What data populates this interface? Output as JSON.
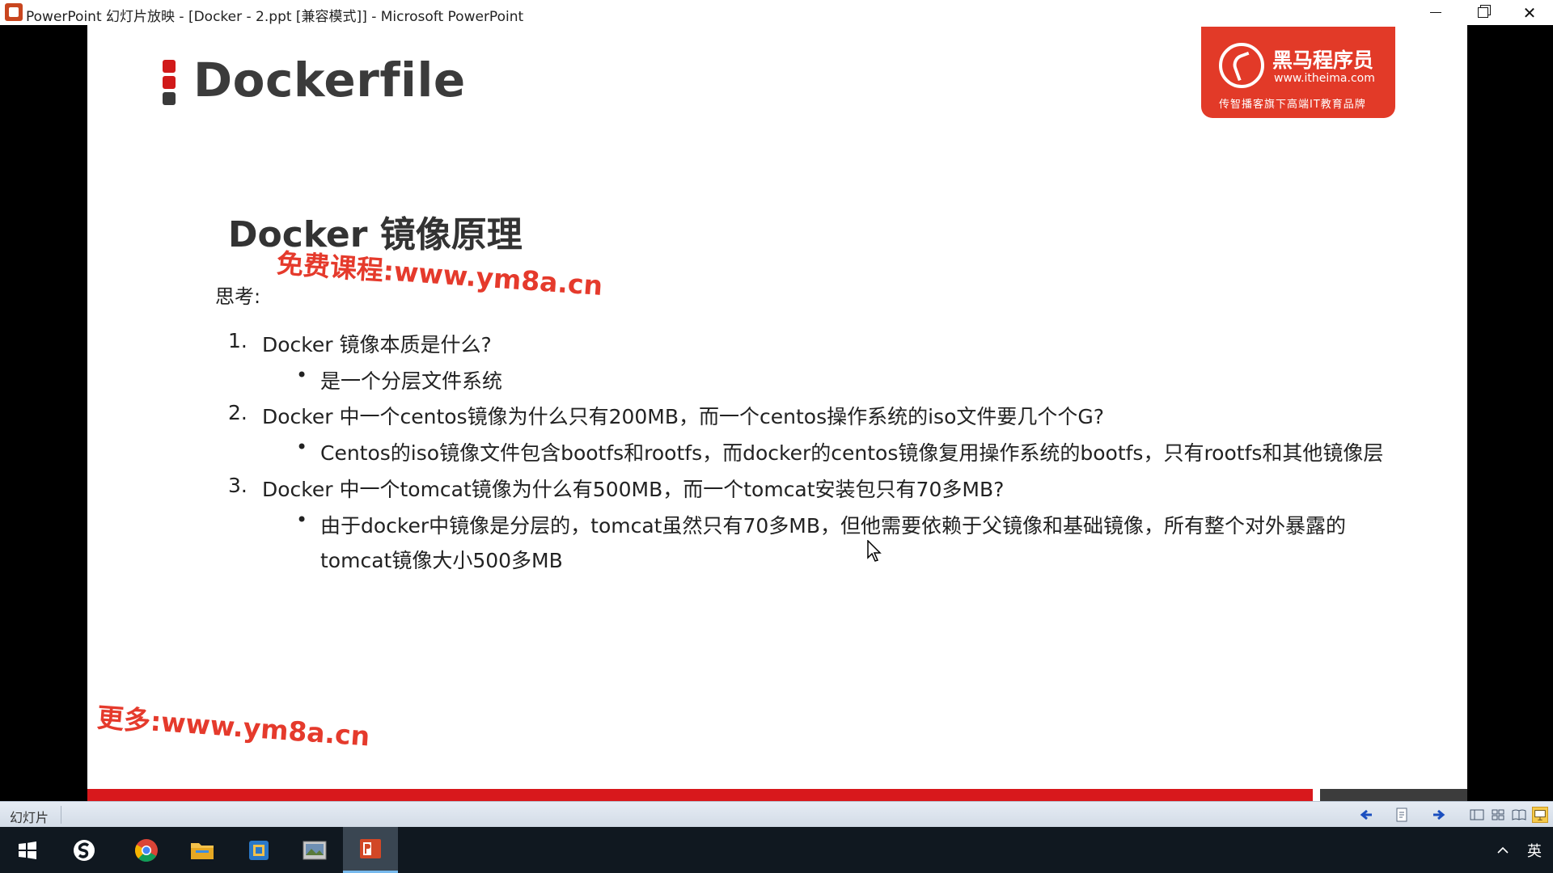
{
  "window": {
    "title": "PowerPoint 幻灯片放映 - [Docker - 2.ppt [兼容模式]] - Microsoft PowerPoint"
  },
  "slide": {
    "title": "Dockerfile",
    "logo": {
      "name": "黑马程序员",
      "url": "www.itheima.com",
      "tagline": "传智播客旗下高端IT教育品牌"
    },
    "heading": "Docker 镜像原理",
    "watermark_top": "免费课程:www.ym8a.cn",
    "watermark_bottom": "更多:www.ym8a.cn",
    "think_label": "思考:",
    "questions": [
      {
        "number": "1.",
        "text": "Docker 镜像本质是什么?",
        "answers": [
          "是一个分层文件系统"
        ]
      },
      {
        "number": "2.",
        "text": "Docker 中一个centos镜像为什么只有200MB，而一个centos操作系统的iso文件要几个个G?",
        "answers": [
          "Centos的iso镜像文件包含bootfs和rootfs，而docker的centos镜像复用操作系统的bootfs，只有rootfs和其他镜像层"
        ]
      },
      {
        "number": "3.",
        "text": "Docker 中一个tomcat镜像为什么有500MB，而一个tomcat安装包只有70多MB?",
        "answers": [
          "由于docker中镜像是分层的，tomcat虽然只有70多MB，但他需要依赖于父镜像和基础镜像，所有整个对外暴露的",
          "tomcat镜像大小500多MB"
        ]
      }
    ]
  },
  "statusbar": {
    "label": "幻灯片"
  },
  "taskbar": {
    "ime": "英"
  },
  "colors": {
    "accent_red": "#d8181c",
    "logo_red": "#e23a28",
    "watermark_red": "#e53a2c"
  }
}
